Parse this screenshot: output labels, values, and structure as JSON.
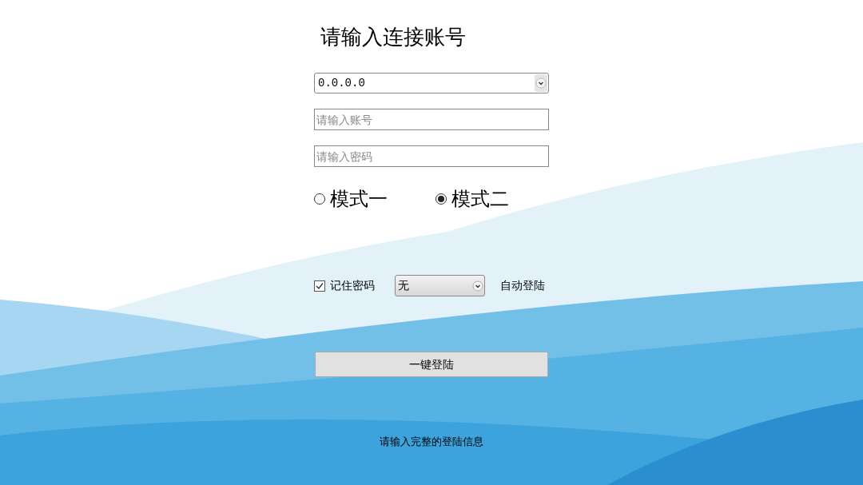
{
  "title": "请输入连接账号",
  "server_select": {
    "value": "0.0.0.0"
  },
  "account_field": {
    "placeholder": "请输入账号"
  },
  "password_field": {
    "placeholder": "请输入密码"
  },
  "modes": [
    {
      "label": "模式一",
      "selected": false
    },
    {
      "label": "模式二",
      "selected": true
    }
  ],
  "remember_password": {
    "label": "记住密码",
    "checked": true
  },
  "auto_login_select": {
    "value": "无"
  },
  "auto_login_label": "自动登陆",
  "login_button": "一键登陆",
  "status_message": "请输入完整的登陆信息"
}
